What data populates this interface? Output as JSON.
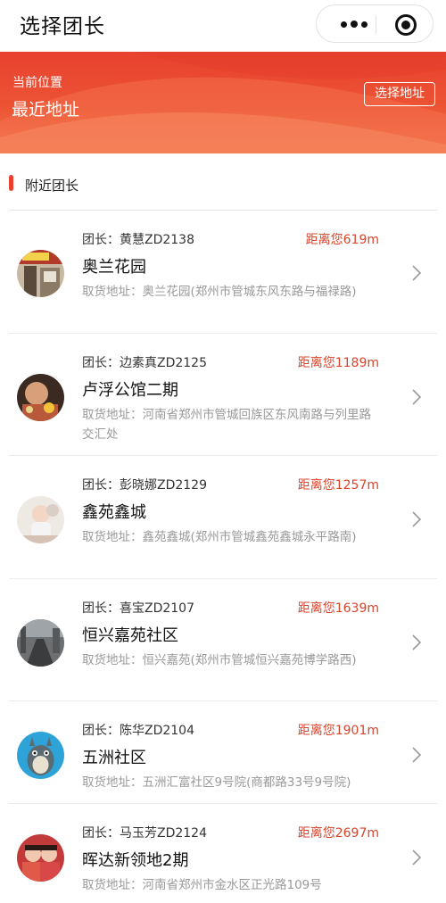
{
  "nav": {
    "title": "选择团长",
    "more_icon": "more-dots-icon",
    "close_icon": "target-close-icon"
  },
  "location": {
    "caption": "当前位置",
    "value": "最近地址",
    "select_button": "选择地址"
  },
  "section": {
    "title": "附近团长"
  },
  "colors": {
    "accent": "#e8412f",
    "distance": "#d9442b",
    "address": "#999999"
  },
  "leaders": [
    {
      "leader": "团长：黄慧ZD2138",
      "distance": "距离您619m",
      "community": "奥兰花园",
      "address": "取货地址：奥兰花园(郑州市管城东风东路与福禄路)"
    },
    {
      "leader": "团长：边素真ZD2125",
      "distance": "距离您1189m",
      "community": "卢浮公馆二期",
      "address": "取货地址：河南省郑州市管城回族区东风南路与列里路交汇处"
    },
    {
      "leader": "团长：彭晓娜ZD2129",
      "distance": "距离您1257m",
      "community": "鑫苑鑫城",
      "address": "取货地址：鑫苑鑫城(郑州市管城鑫苑鑫城永平路南)"
    },
    {
      "leader": "团长：喜宝ZD2107",
      "distance": "距离您1639m",
      "community": "恒兴嘉苑社区",
      "address": "取货地址：恒兴嘉苑(郑州市管城恒兴嘉苑博学路西)"
    },
    {
      "leader": "团长：陈华ZD2104",
      "distance": "距离您1901m",
      "community": "五洲社区",
      "address": "取货地址：五洲汇富社区9号院(商都路33号9号院)"
    },
    {
      "leader": "团长：马玉芳ZD2124",
      "distance": "距离您2697m",
      "community": "晖达新领地2期",
      "address": "取货地址：河南省郑州市金水区正光路109号"
    }
  ]
}
